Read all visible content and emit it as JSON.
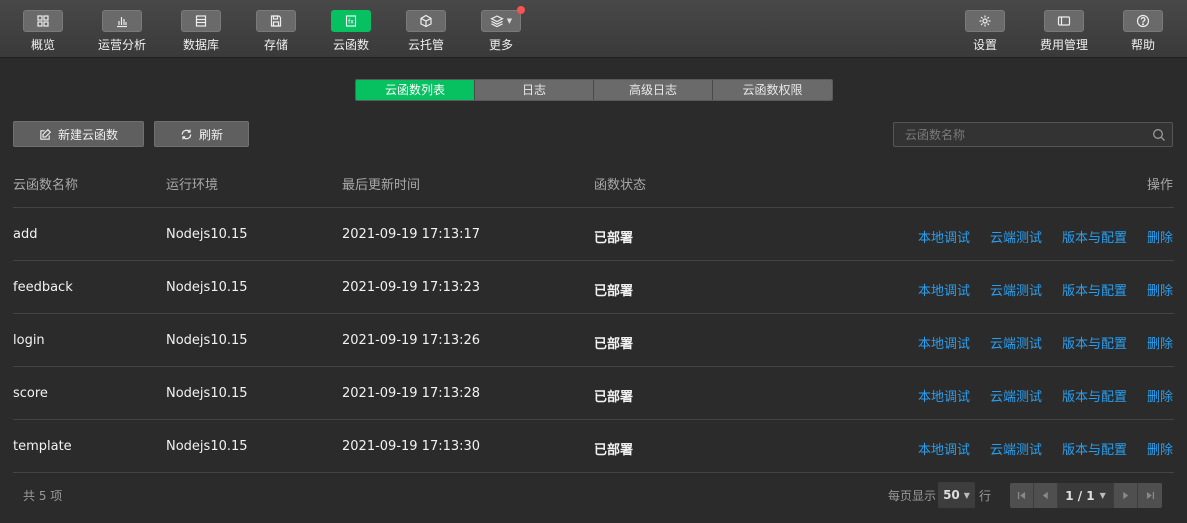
{
  "toolbar": {
    "left": [
      {
        "label": "概览",
        "icon": "grid-icon"
      },
      {
        "label": "运营分析",
        "icon": "bar-chart-icon"
      },
      {
        "label": "数据库",
        "icon": "database-icon"
      },
      {
        "label": "存储",
        "icon": "save-icon"
      },
      {
        "label": "云函数",
        "icon": "function-icon",
        "active": true
      },
      {
        "label": "云托管",
        "icon": "cube-icon"
      },
      {
        "label": "更多",
        "icon": "layers-icon"
      }
    ],
    "right": [
      {
        "label": "设置",
        "icon": "gear-icon"
      },
      {
        "label": "费用管理",
        "icon": "billing-icon"
      },
      {
        "label": "帮助",
        "icon": "help-icon"
      }
    ]
  },
  "tabs": [
    "云函数列表",
    "日志",
    "高级日志",
    "云函数权限"
  ],
  "actions": {
    "create": "新建云函数",
    "refresh": "刷新"
  },
  "search": {
    "placeholder": "云函数名称"
  },
  "table": {
    "columns": [
      "云函数名称",
      "运行环境",
      "最后更新时间",
      "函数状态",
      "操作"
    ],
    "row_actions": [
      "本地调试",
      "云端测试",
      "版本与配置",
      "删除"
    ],
    "rows": [
      {
        "name": "add",
        "runtime": "Nodejs10.15",
        "updated": "2021-09-19 17:13:17",
        "status": "已部署"
      },
      {
        "name": "feedback",
        "runtime": "Nodejs10.15",
        "updated": "2021-09-19 17:13:23",
        "status": "已部署"
      },
      {
        "name": "login",
        "runtime": "Nodejs10.15",
        "updated": "2021-09-19 17:13:26",
        "status": "已部署"
      },
      {
        "name": "score",
        "runtime": "Nodejs10.15",
        "updated": "2021-09-19 17:13:28",
        "status": "已部署"
      },
      {
        "name": "template",
        "runtime": "Nodejs10.15",
        "updated": "2021-09-19 17:13:30",
        "status": "已部署"
      }
    ]
  },
  "footer": {
    "total": "共 5 项",
    "per_page_label": "每页显示",
    "per_page_value": "50",
    "per_page_unit": "行",
    "page": "1 / 1"
  },
  "colors": {
    "accent": "#07c160",
    "link": "#2a9ff0",
    "notify": "#fa5151"
  }
}
